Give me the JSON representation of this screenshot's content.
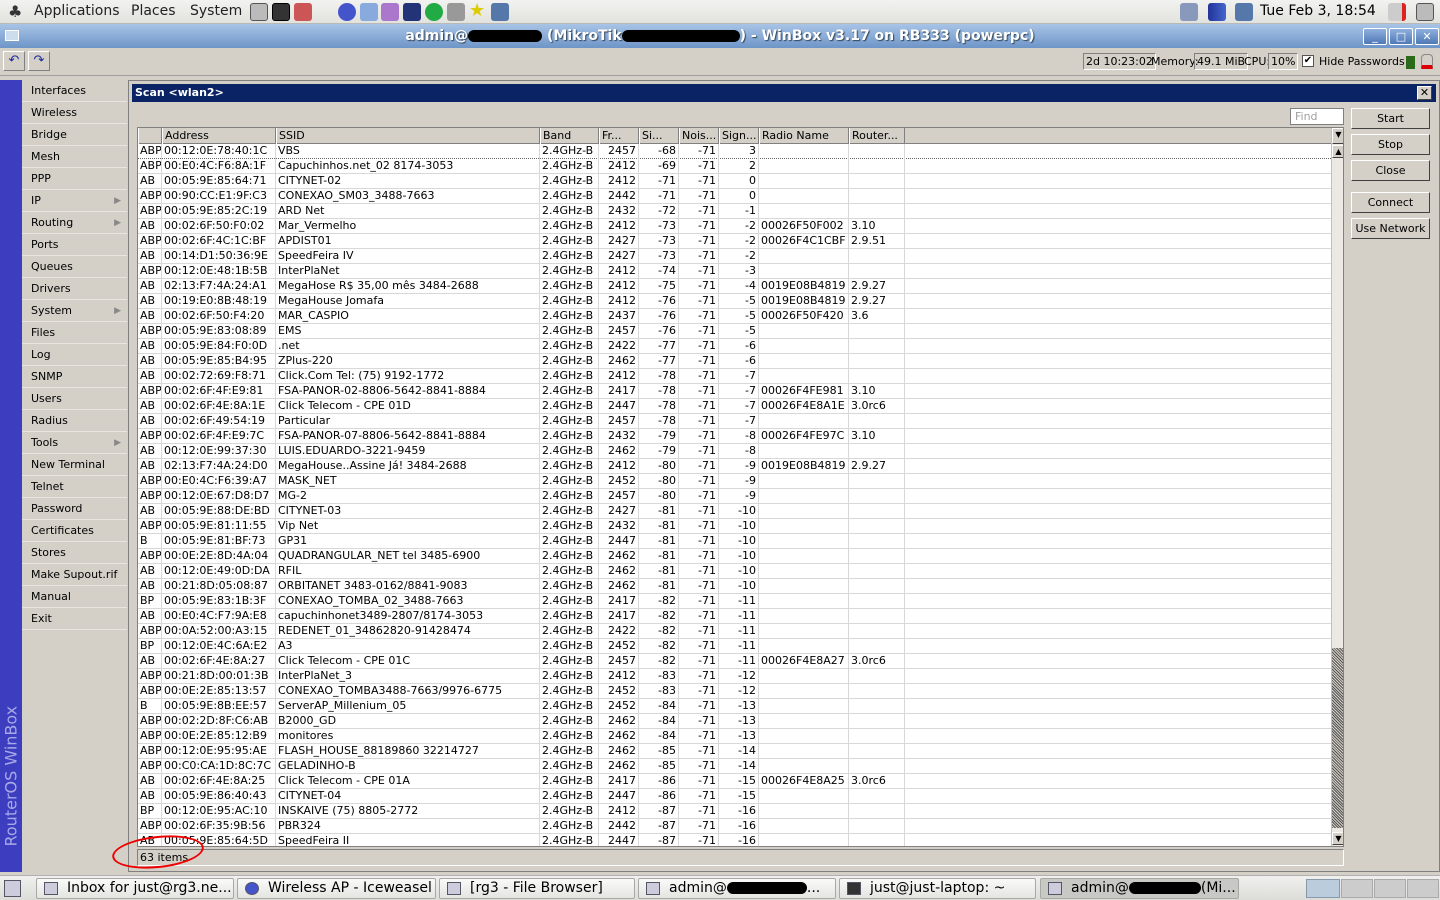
{
  "top_panel": {
    "menus": [
      "Applications",
      "Places",
      "System"
    ],
    "clock": "Tue Feb  3, 18:54"
  },
  "window": {
    "title_prefix": "admin@",
    "title_mid": " (MikroTik",
    "title_suffix": ") - WinBox v3.17 on RB333 (powerpc)",
    "minimize": "_",
    "maximize": "□",
    "close": "✕"
  },
  "toolbar": {
    "undo": "↶",
    "redo": "↷",
    "uptime": "2d 10:23:02",
    "memory_label": "Memory:",
    "memory": "49.1 MiB",
    "cpu_label": "CPU:",
    "cpu": "10%",
    "hide_passwords_label": "Hide Passwords",
    "hide_passwords_checked": true
  },
  "brand": "RouterOS WinBox",
  "sidebar": {
    "items": [
      {
        "label": "Interfaces",
        "sub": false
      },
      {
        "label": "Wireless",
        "sub": false
      },
      {
        "label": "Bridge",
        "sub": false
      },
      {
        "label": "Mesh",
        "sub": false
      },
      {
        "label": "PPP",
        "sub": false
      },
      {
        "label": "IP",
        "sub": true
      },
      {
        "label": "Routing",
        "sub": true
      },
      {
        "label": "Ports",
        "sub": false
      },
      {
        "label": "Queues",
        "sub": false
      },
      {
        "label": "Drivers",
        "sub": false
      },
      {
        "label": "System",
        "sub": true
      },
      {
        "label": "Files",
        "sub": false
      },
      {
        "label": "Log",
        "sub": false
      },
      {
        "label": "SNMP",
        "sub": false
      },
      {
        "label": "Users",
        "sub": false
      },
      {
        "label": "Radius",
        "sub": false
      },
      {
        "label": "Tools",
        "sub": true
      },
      {
        "label": "New Terminal",
        "sub": false
      },
      {
        "label": "Telnet",
        "sub": false
      },
      {
        "label": "Password",
        "sub": false
      },
      {
        "label": "Certificates",
        "sub": false
      },
      {
        "label": "Stores",
        "sub": false
      },
      {
        "label": "Make Supout.rif",
        "sub": false
      },
      {
        "label": "Manual",
        "sub": false
      },
      {
        "label": "Exit",
        "sub": false
      }
    ]
  },
  "scan": {
    "title": "Scan <wlan2>",
    "close": "✕",
    "find_placeholder": "Find",
    "buttons": [
      "Start",
      "Stop",
      "Close",
      "Connect",
      "Use Network"
    ],
    "columns": [
      "",
      "Address",
      "SSID",
      "Band",
      "Fr...",
      "Si...",
      "Nois...",
      "Sign...",
      "Radio Name",
      "Router..."
    ],
    "rows": [
      [
        "ABP",
        "00:12:0E:78:40:1C",
        "VBS",
        "2.4GHz-B",
        "2457",
        "-68",
        "-71",
        "3",
        "",
        ""
      ],
      [
        "ABP",
        "00:E0:4C:F6:8A:1F",
        "Capuchinhos.net_02 8174-3053",
        "2.4GHz-B",
        "2412",
        "-69",
        "-71",
        "2",
        "",
        ""
      ],
      [
        "AB",
        "00:05:9E:85:64:71",
        "CITYNET-02",
        "2.4GHz-B",
        "2412",
        "-71",
        "-71",
        "0",
        "",
        ""
      ],
      [
        "ABP",
        "00:90:CC:E1:9F:C3",
        "CONEXAO_SM03_3488-7663",
        "2.4GHz-B",
        "2442",
        "-71",
        "-71",
        "0",
        "",
        ""
      ],
      [
        "ABP",
        "00:05:9E:85:2C:19",
        "ARD Net",
        "2.4GHz-B",
        "2432",
        "-72",
        "-71",
        "-1",
        "",
        ""
      ],
      [
        "AB",
        "00:02:6F:50:F0:02",
        "Mar_Vermelho",
        "2.4GHz-B",
        "2412",
        "-73",
        "-71",
        "-2",
        "00026F50F002",
        "3.10"
      ],
      [
        "ABP",
        "00:02:6F:4C:1C:BF",
        "APDIST01",
        "2.4GHz-B",
        "2427",
        "-73",
        "-71",
        "-2",
        "00026F4C1CBF",
        "2.9.51"
      ],
      [
        "AB",
        "00:14:D1:50:36:9E",
        "SpeedFeira IV",
        "2.4GHz-B",
        "2427",
        "-73",
        "-71",
        "-2",
        "",
        ""
      ],
      [
        "ABP",
        "00:12:0E:48:1B:5B",
        "InterPlaNet",
        "2.4GHz-B",
        "2412",
        "-74",
        "-71",
        "-3",
        "",
        ""
      ],
      [
        "AB",
        "02:13:F7:4A:24:A1",
        "MegaHose R$ 35,00 mês 3484-2688",
        "2.4GHz-B",
        "2412",
        "-75",
        "-71",
        "-4",
        "0019E08B4819",
        "2.9.27"
      ],
      [
        "AB",
        "00:19:E0:8B:48:19",
        "MegaHouse Jomafa",
        "2.4GHz-B",
        "2412",
        "-76",
        "-71",
        "-5",
        "0019E08B4819",
        "2.9.27"
      ],
      [
        "AB",
        "00:02:6F:50:F4:20",
        "MAR_CASPIO",
        "2.4GHz-B",
        "2437",
        "-76",
        "-71",
        "-5",
        "00026F50F420",
        "3.6"
      ],
      [
        "ABP",
        "00:05:9E:83:08:89",
        "EMS",
        "2.4GHz-B",
        "2457",
        "-76",
        "-71",
        "-5",
        "",
        ""
      ],
      [
        "AB",
        "00:05:9E:84:F0:0D",
        ".net",
        "2.4GHz-B",
        "2422",
        "-77",
        "-71",
        "-6",
        "",
        ""
      ],
      [
        "AB",
        "00:05:9E:85:B4:95",
        "ZPlus-220",
        "2.4GHz-B",
        "2462",
        "-77",
        "-71",
        "-6",
        "",
        ""
      ],
      [
        "AB",
        "00:02:72:69:F8:71",
        "Click.Com Tel: (75) 9192-1772",
        "2.4GHz-B",
        "2412",
        "-78",
        "-71",
        "-7",
        "",
        ""
      ],
      [
        "ABP",
        "00:02:6F:4F:E9:81",
        "FSA-PANOR-02-8806-5642-8841-8884",
        "2.4GHz-B",
        "2417",
        "-78",
        "-71",
        "-7",
        "00026F4FE981",
        "3.10"
      ],
      [
        "AB",
        "00:02:6F:4E:8A:1E",
        "Click Telecom - CPE 01D",
        "2.4GHz-B",
        "2447",
        "-78",
        "-71",
        "-7",
        "00026F4E8A1E",
        "3.0rc6"
      ],
      [
        "AB",
        "00:02:6F:49:54:19",
        "Particular",
        "2.4GHz-B",
        "2457",
        "-78",
        "-71",
        "-7",
        "",
        ""
      ],
      [
        "ABP",
        "00:02:6F:4F:E9:7C",
        "FSA-PANOR-07-8806-5642-8841-8884",
        "2.4GHz-B",
        "2432",
        "-79",
        "-71",
        "-8",
        "00026F4FE97C",
        "3.10"
      ],
      [
        "AB",
        "00:12:0E:99:37:30",
        "LUIS.EDUARDO-3221-9459",
        "2.4GHz-B",
        "2462",
        "-79",
        "-71",
        "-8",
        "",
        ""
      ],
      [
        "AB",
        "02:13:F7:4A:24:D0",
        "MegaHouse..Assine Já! 3484-2688",
        "2.4GHz-B",
        "2412",
        "-80",
        "-71",
        "-9",
        "0019E08B4819",
        "2.9.27"
      ],
      [
        "ABP",
        "00:E0:4C:F6:39:A7",
        "MASK_NET",
        "2.4GHz-B",
        "2452",
        "-80",
        "-71",
        "-9",
        "",
        ""
      ],
      [
        "ABP",
        "00:12:0E:67:D8:D7",
        "MG-2",
        "2.4GHz-B",
        "2457",
        "-80",
        "-71",
        "-9",
        "",
        ""
      ],
      [
        "AB",
        "00:05:9E:88:DE:BD",
        "CITYNET-03",
        "2.4GHz-B",
        "2427",
        "-81",
        "-71",
        "-10",
        "",
        ""
      ],
      [
        "ABP",
        "00:05:9E:81:11:55",
        "Vip Net",
        "2.4GHz-B",
        "2432",
        "-81",
        "-71",
        "-10",
        "",
        ""
      ],
      [
        "B",
        "00:05:9E:81:BF:73",
        "GP31",
        "2.4GHz-B",
        "2447",
        "-81",
        "-71",
        "-10",
        "",
        ""
      ],
      [
        "ABP",
        "00:0E:2E:8D:4A:04",
        "QUADRANGULAR_NET tel 3485-6900",
        "2.4GHz-B",
        "2462",
        "-81",
        "-71",
        "-10",
        "",
        ""
      ],
      [
        "AB",
        "00:12:0E:49:0D:DA",
        "RFIL",
        "2.4GHz-B",
        "2462",
        "-81",
        "-71",
        "-10",
        "",
        ""
      ],
      [
        "AB",
        "00:21:8D:05:08:87",
        "ORBITANET  3483-0162/8841-9083",
        "2.4GHz-B",
        "2462",
        "-81",
        "-71",
        "-10",
        "",
        ""
      ],
      [
        "BP",
        "00:05:9E:83:1B:3F",
        "CONEXAO_TOMBA_02_3488-7663",
        "2.4GHz-B",
        "2417",
        "-82",
        "-71",
        "-11",
        "",
        ""
      ],
      [
        "AB",
        "00:E0:4C:F7:9A:E8",
        "capuchinhonet3489-2807/8174-3053",
        "2.4GHz-B",
        "2417",
        "-82",
        "-71",
        "-11",
        "",
        ""
      ],
      [
        "ABP",
        "00:0A:52:00:A3:15",
        "REDENET_01_34862820-91428474",
        "2.4GHz-B",
        "2422",
        "-82",
        "-71",
        "-11",
        "",
        ""
      ],
      [
        "BP",
        "00:12:0E:4C:6A:E2",
        "A3",
        "2.4GHz-B",
        "2452",
        "-82",
        "-71",
        "-11",
        "",
        ""
      ],
      [
        "AB",
        "00:02:6F:4E:8A:27",
        "Click Telecom - CPE 01C",
        "2.4GHz-B",
        "2457",
        "-82",
        "-71",
        "-11",
        "00026F4E8A27",
        "3.0rc6"
      ],
      [
        "ABP",
        "00:21:8D:00:01:3B",
        "InterPlaNet_3",
        "2.4GHz-B",
        "2412",
        "-83",
        "-71",
        "-12",
        "",
        ""
      ],
      [
        "ABP",
        "00:0E:2E:85:13:57",
        "CONEXAO_TOMBA3488-7663/9976-6775",
        "2.4GHz-B",
        "2452",
        "-83",
        "-71",
        "-12",
        "",
        ""
      ],
      [
        "B",
        "00:05:9E:8B:EE:57",
        "ServerAP_Millenium_05",
        "2.4GHz-B",
        "2452",
        "-84",
        "-71",
        "-13",
        "",
        ""
      ],
      [
        "ABP",
        "00:02:2D:8F:C6:AB",
        "B2000_GD",
        "2.4GHz-B",
        "2462",
        "-84",
        "-71",
        "-13",
        "",
        ""
      ],
      [
        "ABP",
        "00:0E:2E:85:12:B9",
        "monitores",
        "2.4GHz-B",
        "2462",
        "-84",
        "-71",
        "-13",
        "",
        ""
      ],
      [
        "ABP",
        "00:12:0E:95:95:AE",
        "FLASH_HOUSE_88189860 32214727",
        "2.4GHz-B",
        "2462",
        "-85",
        "-71",
        "-14",
        "",
        ""
      ],
      [
        "ABP",
        "00:C0:CA:1D:8C:7C",
        "GELADINHO-B",
        "2.4GHz-B",
        "2462",
        "-85",
        "-71",
        "-14",
        "",
        ""
      ],
      [
        "AB",
        "00:02:6F:4E:8A:25",
        "Click Telecom - CPE 01A",
        "2.4GHz-B",
        "2417",
        "-86",
        "-71",
        "-15",
        "00026F4E8A25",
        "3.0rc6"
      ],
      [
        "AB",
        "00:05:9E:86:40:43",
        "CITYNET-04",
        "2.4GHz-B",
        "2447",
        "-86",
        "-71",
        "-15",
        "",
        ""
      ],
      [
        "BP",
        "00:12:0E:95:AC:10",
        "INSKAIVE (75) 8805-2772",
        "2.4GHz-B",
        "2412",
        "-87",
        "-71",
        "-16",
        "",
        ""
      ],
      [
        "ABP",
        "00:02:6F:35:9B:56",
        "PBR324",
        "2.4GHz-B",
        "2442",
        "-87",
        "-71",
        "-16",
        "",
        ""
      ],
      [
        "AB",
        "00:05:9E:85:64:5D",
        "SpeedFeira II",
        "2.4GHz-B",
        "2447",
        "-87",
        "-71",
        "-16",
        "",
        ""
      ]
    ],
    "status": "63 items"
  },
  "taskbar": {
    "tasks": [
      "Inbox for just@rg3.ne...",
      "Wireless AP - Iceweasel",
      "[rg3 - File Browser]",
      "admin@",
      "just@just-laptop: ~",
      "admin@"
    ],
    "task_suffixes": [
      "",
      "",
      "",
      "...",
      "",
      "(Mi..."
    ]
  },
  "colors": {
    "title_navy": "#0a2364",
    "strip_blue": "#3d3dc0",
    "annotation_red": "#e00000"
  }
}
